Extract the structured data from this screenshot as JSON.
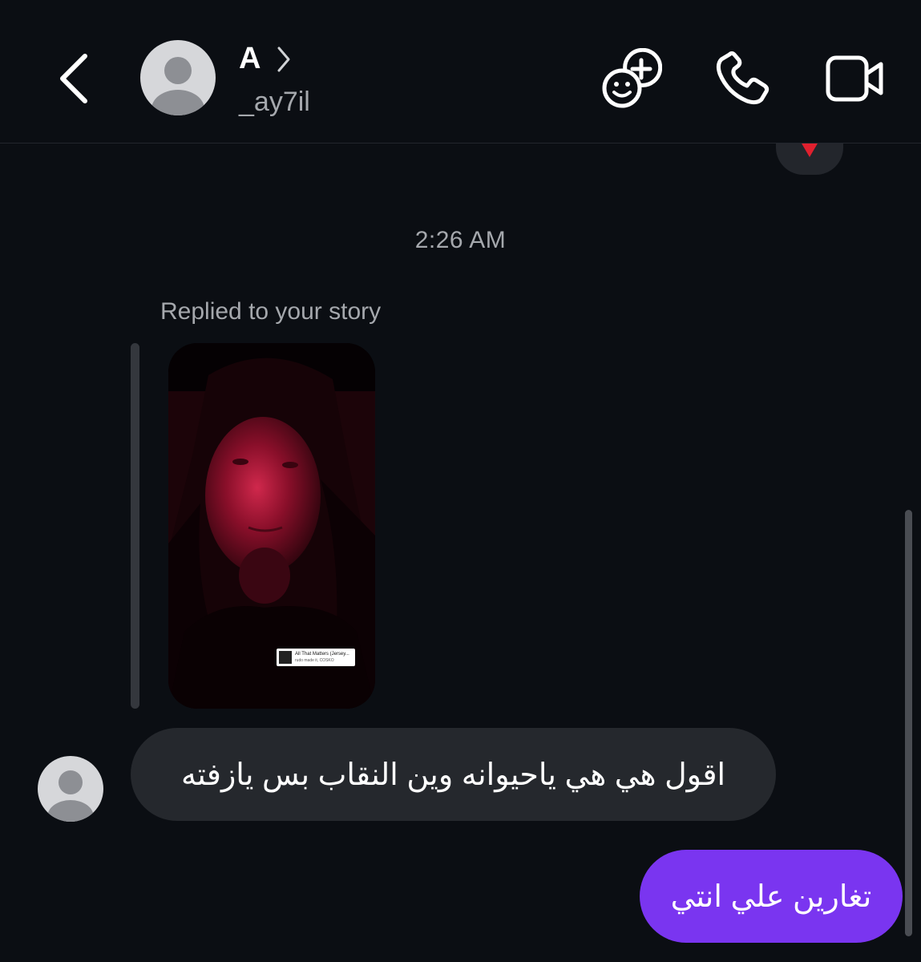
{
  "header": {
    "display_name": "A",
    "username": "_ay7il"
  },
  "thread": {
    "timestamp": "2:26 AM",
    "replied_label": "Replied to your story",
    "story_music": {
      "title": "All That Matters (Jersey...",
      "artist": "rudo made it, COSKO"
    },
    "incoming_message": "اقول هي هي ياحيوانه وين النقاب بس يازفته",
    "outgoing_message": "تغارين علي انتي"
  },
  "icons": {
    "back": "chevron-left-icon",
    "profile_chevron": "chevron-right-icon",
    "games": "game-face-plus-icon",
    "call": "phone-icon",
    "video": "video-camera-icon",
    "reaction": "heart-icon"
  },
  "colors": {
    "background": "#0b0e13",
    "incoming_bubble": "#25282d",
    "outgoing_bubble": "#7a35f0",
    "secondary_text": "#a5a8ad",
    "heart": "#e0202e"
  }
}
